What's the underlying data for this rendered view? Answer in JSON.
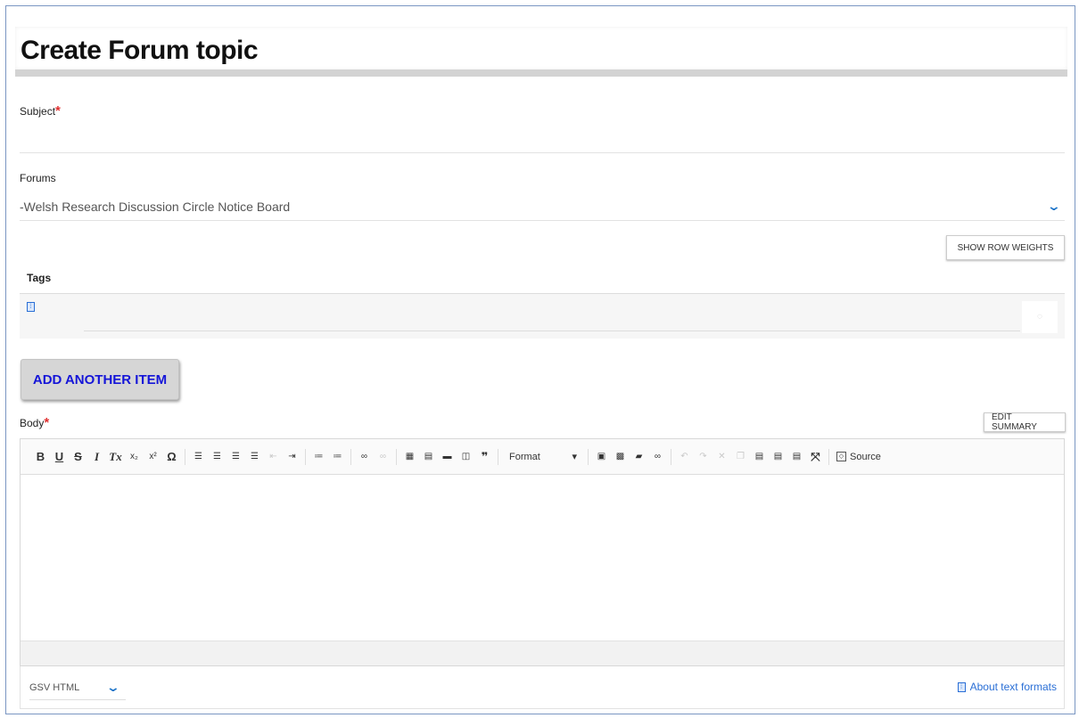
{
  "page": {
    "title": "Create Forum topic"
  },
  "subject": {
    "label": "Subject",
    "required_mark": "*",
    "value": ""
  },
  "forums": {
    "label": "Forums",
    "selected": "-Welsh Research Discussion Circle Notice Board",
    "chevron_icon": "chevron-down-icon"
  },
  "tags": {
    "show_row_weights_label": "SHOW ROW WEIGHTS",
    "header": "Tags",
    "drag_icon": "drag-handle-icon",
    "autocomplete_icon": "autocomplete-icon",
    "add_another_label": "ADD ANOTHER ITEM"
  },
  "body": {
    "label": "Body",
    "required_mark": "*",
    "edit_summary_label": "EDIT SUMMARY",
    "toolbar": {
      "bold": "B",
      "underline": "U",
      "strike": "S",
      "italic": "I",
      "remove_format": "Tx",
      "subscript": "x₂",
      "superscript": "x²",
      "special_char": "Ω",
      "format_label": "Format",
      "format_arrow": "▾",
      "source_label": "Source"
    }
  },
  "text_format": {
    "selected": "GSV HTML",
    "about_label": "About text formats"
  },
  "colors": {
    "accent_blue": "#1a73c8",
    "required_red": "#e03030",
    "add_button_text": "#1515d8"
  }
}
